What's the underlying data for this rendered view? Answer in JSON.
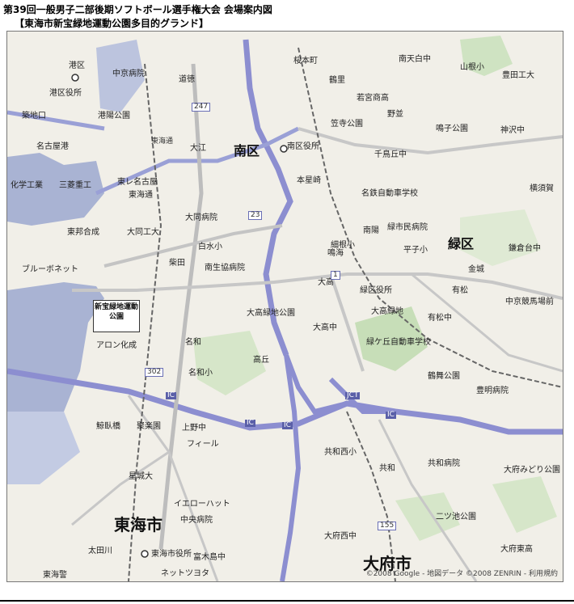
{
  "header": {
    "title": "第39回一般男子二部後期ソフトボール選手権大会 会場案内図",
    "subtitle": "【東海市新宝緑地運動公園多目的グランド】"
  },
  "map": {
    "venue_label": "新宝緑地運動公園",
    "copyright": "©2008 Google - 地図データ ©2008 ZENRIN - 利用規約",
    "labels": {
      "minato_ku": "港区",
      "minami_ku": "南区",
      "midori_ku": "緑区",
      "tokai_shi": "東海市",
      "obu_shi": "大府市",
      "tokai_dori": "東海通",
      "minato_kuyakusho": "港区役所",
      "chikko_guchi": "築地口",
      "minato_koen": "港陽公園",
      "nagoyako": "名古屋港",
      "chuo_byoin": "中京病院",
      "hitozakura": "道徳",
      "higashi_yokkaichi": "東海通",
      "shinbashi": "大江",
      "minami_kuyakusho": "南区役所",
      "sakura": "桜本町",
      "toyama": "鶴里",
      "kasadera": "笠寺公園",
      "wakamiya": "若宮商高",
      "nodate": "野並",
      "minami_tenpaku": "南天白中",
      "sansho": "山根小",
      "toyota_kogyo": "豊田工大",
      "narumi_koen": "鳴子公園",
      "kamisawa": "神沢中",
      "daido_kogyo": "大同工大",
      "daido_byoin": "大同病院",
      "shiratori": "白水小",
      "minamiseikyo": "南生協病院",
      "shibata": "柴田",
      "meiwa": "名和",
      "meiwa_sho": "名和小",
      "kagaku_kogyo": "化学工業",
      "mitsubishi_jikouki": "三菱重工",
      "higashi_nagoya_kou": "東レ名古屋",
      "toho_gas": "東邦合成",
      "blue_bonnet": "ブルーボネット",
      "aron_kasei": "アロン化成",
      "kaisei": "聚楽園",
      "kamino_cho": "上野中",
      "field": "フィール",
      "uminoko": "鯨臥橋",
      "hoshizaki": "星城大",
      "ion_hat": "イエローハット",
      "chuo_byoin2": "中央病院",
      "ota_kawa": "太田川",
      "tokai_shiyakusho": "東海市役所",
      "tomiki_shima": "富木島中",
      "network_yoko": "ネットツヨタ",
      "tokai_gei": "東海警",
      "kyowa": "共和",
      "kyowa_nishi": "共和西小",
      "kyowa_byoin": "共和病院",
      "futatsu_ike": "二ツ池公園",
      "obu_nishi": "大府西中",
      "obu_midori": "大府みどり公園",
      "obu_higashi": "大府東高",
      "kotakayama": "高丘",
      "oyama_koen": "大高緑地公園",
      "odaka": "大高",
      "odaka_chu": "大高中",
      "odaka_ryokuchi": "大高緑地",
      "midorigaoka": "緑ケ丘自動車学校",
      "narumi": "鳴海",
      "midori_kuyakusho": "緑区役所",
      "arimatsu": "有松",
      "arimatsu_chu": "有松中",
      "hirako": "平子小",
      "toyoake_koen": "鶴舞公園",
      "toyoake_byoin": "豊明病院",
      "chukyo_keiba": "中京競馬場前",
      "kamakura_dai": "鎌倉台中",
      "meikyo_jidosha": "名鉄自動車学校",
      "midori_shimin": "緑市民病院",
      "senjo_chu": "千鳥丘中",
      "motohoshizaki": "本星崎",
      "hosokami": "細根小",
      "minamiyo": "南陽",
      "kinjo_jido": "金城",
      "yokosuka": "横須賀"
    },
    "road_numbers": [
      "247",
      "302",
      "23",
      "1",
      "155"
    ],
    "ic_labels": [
      "IC",
      "IC",
      "IC",
      "IC",
      "JCT"
    ]
  }
}
